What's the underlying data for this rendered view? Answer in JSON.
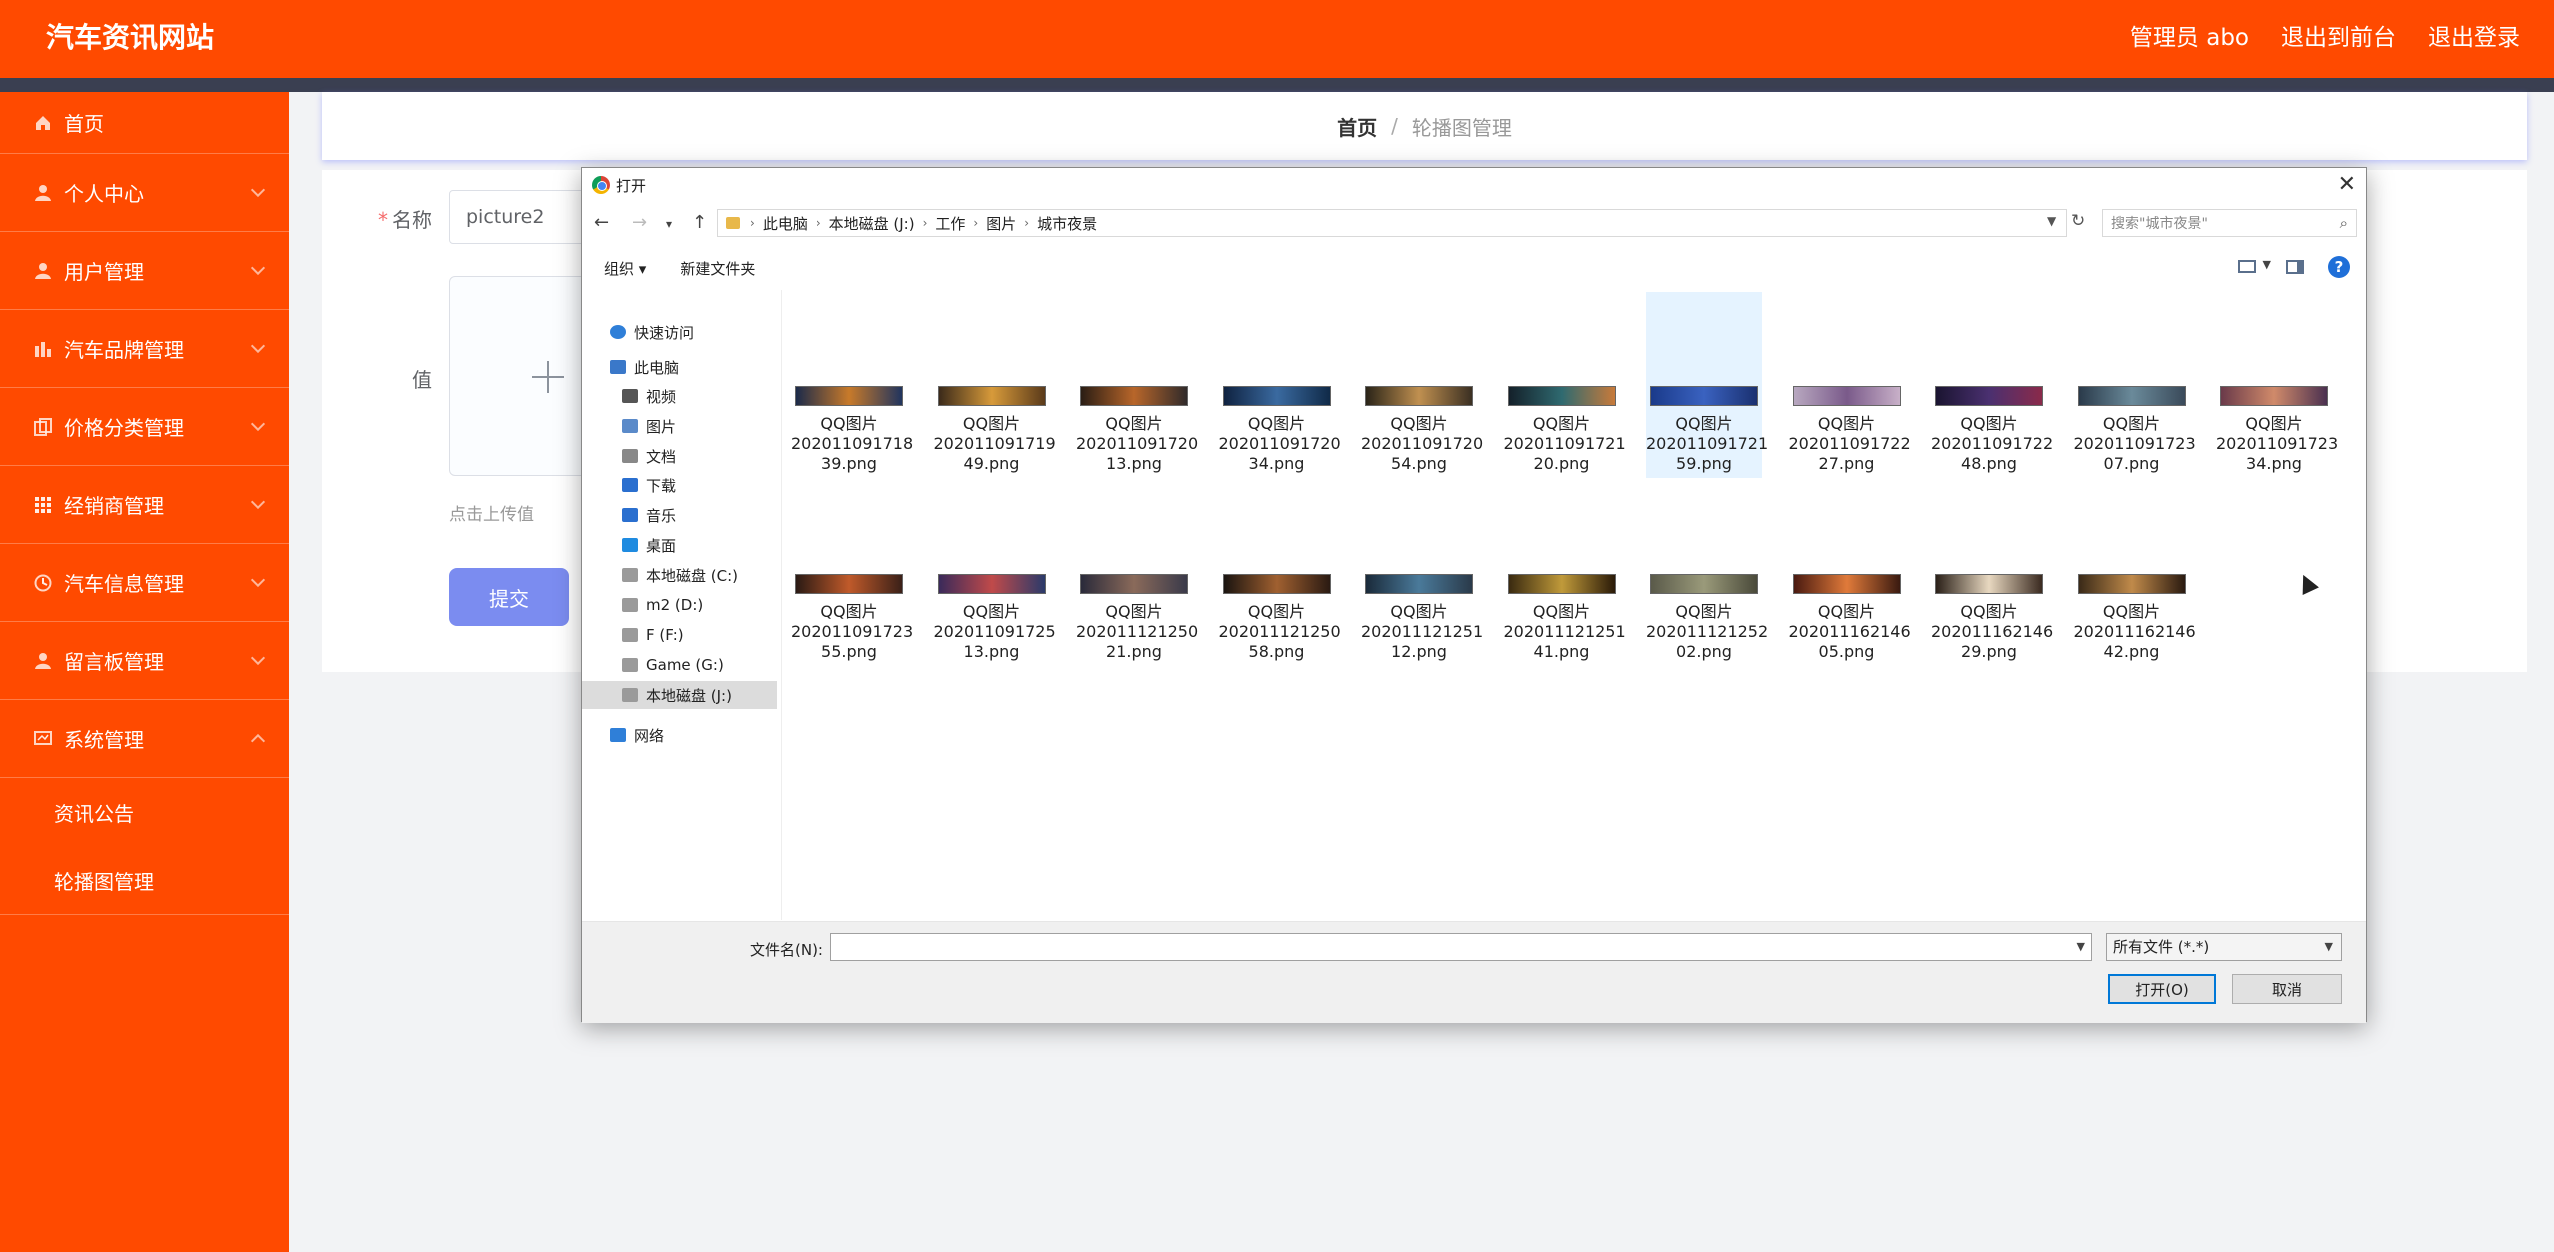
{
  "header": {
    "site_title": "汽车资讯网站",
    "links": [
      "管理员 abo",
      "退出到前台",
      "退出登录"
    ]
  },
  "sidebar": {
    "items": [
      {
        "label": "首页",
        "icon": "home-icon"
      },
      {
        "label": "个人中心",
        "icon": "user-icon"
      },
      {
        "label": "用户管理",
        "icon": "user-icon"
      },
      {
        "label": "汽车品牌管理",
        "icon": "bars-icon"
      },
      {
        "label": "价格分类管理",
        "icon": "copy-icon"
      },
      {
        "label": "经销商管理",
        "icon": "grid-icon"
      },
      {
        "label": "汽车信息管理",
        "icon": "clock-icon"
      },
      {
        "label": "留言板管理",
        "icon": "user-icon"
      },
      {
        "label": "系统管理",
        "icon": "monitor-icon"
      }
    ],
    "sub_items": [
      "资讯公告",
      "轮播图管理"
    ]
  },
  "breadcrumb": {
    "home": "首页",
    "separator": "/",
    "current": "轮播图管理"
  },
  "form": {
    "name_label": "名称",
    "name_required_mark": "*",
    "name_value": "picture2",
    "value_label": "值",
    "upload_tip": "点击上传值",
    "submit_label": "提交"
  },
  "dialog": {
    "title": "打开",
    "close": "✕",
    "address": [
      "此电脑",
      "本地磁盘 (J:)",
      "工作",
      "图片",
      "城市夜景"
    ],
    "search_placeholder": "搜索\"城市夜景\"",
    "toolbar": {
      "organize": "组织 ▾",
      "new_folder": "新建文件夹"
    },
    "help": "?",
    "nav_items": [
      {
        "label": "快速访问",
        "icon": "star-icon"
      },
      {
        "label": "此电脑",
        "icon": "computer-icon"
      },
      {
        "label": "视频",
        "icon": "video-icon"
      },
      {
        "label": "图片",
        "icon": "picture-icon"
      },
      {
        "label": "文档",
        "icon": "document-icon"
      },
      {
        "label": "下载",
        "icon": "download-icon"
      },
      {
        "label": "音乐",
        "icon": "music-icon"
      },
      {
        "label": "桌面",
        "icon": "desktop-icon"
      },
      {
        "label": "本地磁盘 (C:)",
        "icon": "drive-icon"
      },
      {
        "label": "m2 (D:)",
        "icon": "drive-icon"
      },
      {
        "label": "F (F:)",
        "icon": "drive-icon"
      },
      {
        "label": "Game (G:)",
        "icon": "drive-icon"
      },
      {
        "label": "本地磁盘 (J:)",
        "icon": "drive-icon"
      },
      {
        "label": "网络",
        "icon": "network-icon"
      }
    ],
    "files": [
      {
        "line1": "QQ图片",
        "line2": "202011091718",
        "line3": "39.png"
      },
      {
        "line1": "QQ图片",
        "line2": "202011091719",
        "line3": "49.png"
      },
      {
        "line1": "QQ图片",
        "line2": "202011091720",
        "line3": "13.png"
      },
      {
        "line1": "QQ图片",
        "line2": "202011091720",
        "line3": "34.png"
      },
      {
        "line1": "QQ图片",
        "line2": "202011091720",
        "line3": "54.png"
      },
      {
        "line1": "QQ图片",
        "line2": "202011091721",
        "line3": "20.png"
      },
      {
        "line1": "QQ图片",
        "line2": "202011091721",
        "line3": "59.png"
      },
      {
        "line1": "QQ图片",
        "line2": "202011091722",
        "line3": "27.png"
      },
      {
        "line1": "QQ图片",
        "line2": "202011091722",
        "line3": "48.png"
      },
      {
        "line1": "QQ图片",
        "line2": "202011091723",
        "line3": "07.png"
      },
      {
        "line1": "QQ图片",
        "line2": "202011091723",
        "line3": "34.png"
      },
      {
        "line1": "QQ图片",
        "line2": "202011091723",
        "line3": "55.png"
      },
      {
        "line1": "QQ图片",
        "line2": "202011091725",
        "line3": "13.png"
      },
      {
        "line1": "QQ图片",
        "line2": "202011121250",
        "line3": "21.png"
      },
      {
        "line1": "QQ图片",
        "line2": "202011121250",
        "line3": "58.png"
      },
      {
        "line1": "QQ图片",
        "line2": "202011121251",
        "line3": "12.png"
      },
      {
        "line1": "QQ图片",
        "line2": "202011121251",
        "line3": "41.png"
      },
      {
        "line1": "QQ图片",
        "line2": "202011121252",
        "line3": "02.png"
      },
      {
        "line1": "QQ图片",
        "line2": "202011162146",
        "line3": "05.png"
      },
      {
        "line1": "QQ图片",
        "line2": "202011162146",
        "line3": "29.png"
      },
      {
        "line1": "QQ图片",
        "line2": "202011162146",
        "line3": "42.png"
      }
    ],
    "selected_file_index": 6,
    "selected_nav_index": 12,
    "filename_label": "文件名(N):",
    "filename_value": "",
    "filetype_value": "所有文件 (*.*)",
    "open_label": "打开(O)",
    "cancel_label": "取消"
  },
  "colors": {
    "brand": "#ff4a00",
    "dark_strip": "#3a3f51",
    "submit": "#7b8cf0",
    "selection": "#e5f3ff"
  }
}
